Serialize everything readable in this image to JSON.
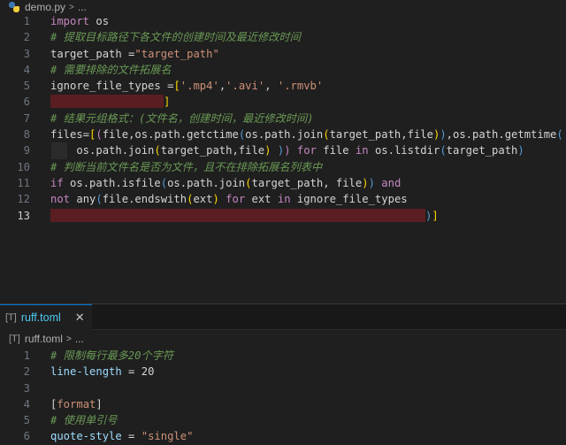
{
  "editor1": {
    "file_name": "demo.py",
    "breadcrumb_sep": ">",
    "breadcrumb_more": "...",
    "active_line": 13,
    "lines": [
      {
        "n": "1",
        "tokens": [
          {
            "t": "import",
            "c": "kw"
          },
          {
            "t": " os",
            "c": "pn"
          }
        ]
      },
      {
        "n": "2",
        "tokens": [
          {
            "t": "# 提取目标路径下各文件的创建时间及最近修改时间",
            "c": "cmt"
          }
        ]
      },
      {
        "n": "3",
        "tokens": [
          {
            "t": "target_path",
            "c": "pn"
          },
          {
            "t": " =",
            "c": "pn"
          },
          {
            "t": "\"target_path\"",
            "c": "str"
          }
        ]
      },
      {
        "n": "4",
        "tokens": [
          {
            "t": "# 需要排除的文件拓展名",
            "c": "cmt"
          }
        ]
      },
      {
        "n": "5",
        "tokens": [
          {
            "t": "ignore_file_types",
            "c": "pn"
          },
          {
            "t": " =",
            "c": "pn"
          },
          {
            "t": "[",
            "c": "brk"
          },
          {
            "t": "'.mp4'",
            "c": "str"
          },
          {
            "t": ",",
            "c": "pn"
          },
          {
            "t": "'.avi'",
            "c": "str"
          },
          {
            "t": ", ",
            "c": "pn"
          },
          {
            "t": "'.rmvb'",
            "c": "str"
          }
        ]
      },
      {
        "n": "6",
        "tokens": [
          {
            "t": "",
            "c": "redact",
            "w": 128
          },
          {
            "t": "]",
            "c": "brk"
          }
        ]
      },
      {
        "n": "7",
        "tokens": [
          {
            "t": "# 结果元组格式：(文件名，创建时间，最近修改时间)",
            "c": "cmt"
          }
        ]
      },
      {
        "n": "8",
        "tokens": [
          {
            "t": "files",
            "c": "pn"
          },
          {
            "t": "=",
            "c": "pn"
          },
          {
            "t": "[",
            "c": "brk"
          },
          {
            "t": "(",
            "c": "kw"
          },
          {
            "t": "file,os.path.getctime",
            "c": "pn"
          },
          {
            "t": "(",
            "c": "kw2"
          },
          {
            "t": "os.path.join",
            "c": "pn"
          },
          {
            "t": "(",
            "c": "brk"
          },
          {
            "t": "target_path,file",
            "c": "pn"
          },
          {
            "t": ")",
            "c": "brk"
          },
          {
            "t": ")",
            "c": "kw2"
          },
          {
            "t": ",os.path.getmtime",
            "c": "pn"
          },
          {
            "t": "(",
            "c": "kw2"
          }
        ]
      },
      {
        "n": "9",
        "indent": true,
        "tokens": [
          {
            "t": "    os.path.join",
            "c": "pn"
          },
          {
            "t": "(",
            "c": "brk"
          },
          {
            "t": "target_path,file",
            "c": "pn"
          },
          {
            "t": ")",
            "c": "brk"
          },
          {
            "t": " )",
            "c": "kw2"
          },
          {
            "t": ") ",
            "c": "kw"
          },
          {
            "t": "for",
            "c": "kw"
          },
          {
            "t": " file ",
            "c": "pn"
          },
          {
            "t": "in",
            "c": "kw"
          },
          {
            "t": " os.listdir",
            "c": "pn"
          },
          {
            "t": "(",
            "c": "kw2"
          },
          {
            "t": "target_path",
            "c": "pn"
          },
          {
            "t": ")",
            "c": "kw2"
          }
        ]
      },
      {
        "n": "10",
        "tokens": [
          {
            "t": "# 判断当前文件名是否为文件，且不在排除拓展名列表中",
            "c": "cmt"
          }
        ]
      },
      {
        "n": "11",
        "tokens": [
          {
            "t": "if",
            "c": "kw"
          },
          {
            "t": " os.path.isfile",
            "c": "pn"
          },
          {
            "t": "(",
            "c": "kw2"
          },
          {
            "t": "os.path.join",
            "c": "pn"
          },
          {
            "t": "(",
            "c": "brk"
          },
          {
            "t": "target_path, file",
            "c": "pn"
          },
          {
            "t": ")",
            "c": "brk"
          },
          {
            "t": ")",
            "c": "kw2"
          },
          {
            "t": " and",
            "c": "kw"
          }
        ]
      },
      {
        "n": "12",
        "tokens": [
          {
            "t": "not",
            "c": "kw"
          },
          {
            "t": " any",
            "c": "pn"
          },
          {
            "t": "(",
            "c": "kw2"
          },
          {
            "t": "file.endswith",
            "c": "pn"
          },
          {
            "t": "(",
            "c": "brk"
          },
          {
            "t": "ext",
            "c": "pn"
          },
          {
            "t": ")",
            "c": "brk"
          },
          {
            "t": " for",
            "c": "kw"
          },
          {
            "t": " ext ",
            "c": "pn"
          },
          {
            "t": "in",
            "c": "kw"
          },
          {
            "t": " ignore_file_types",
            "c": "pn"
          }
        ]
      },
      {
        "n": "13",
        "tokens": [
          {
            "t": "",
            "c": "redact",
            "w": 424
          },
          {
            "t": ")",
            "c": "kw2"
          },
          {
            "t": "]",
            "c": "brk"
          }
        ]
      }
    ]
  },
  "tab2": {
    "icon": "[T]",
    "file_name": "ruff.toml",
    "close_glyph": "✕"
  },
  "editor2": {
    "icon": "[T]",
    "file_name": "ruff.toml",
    "breadcrumb_sep": ">",
    "breadcrumb_more": "...",
    "lines": [
      {
        "n": "1",
        "tokens": [
          {
            "t": "# 限制每行最多20个字符",
            "c": "cmt"
          }
        ]
      },
      {
        "n": "2",
        "tokens": [
          {
            "t": "line-length",
            "c": "id"
          },
          {
            "t": " = ",
            "c": "pn"
          },
          {
            "t": "20",
            "c": "pn"
          }
        ]
      },
      {
        "n": "3",
        "tokens": []
      },
      {
        "n": "4",
        "tokens": [
          {
            "t": "[",
            "c": "pn"
          },
          {
            "t": "format",
            "c": "str"
          },
          {
            "t": "]",
            "c": "pn"
          }
        ]
      },
      {
        "n": "5",
        "tokens": [
          {
            "t": "# 使用单引号",
            "c": "cmt"
          }
        ]
      },
      {
        "n": "6",
        "tokens": [
          {
            "t": "quote-style",
            "c": "id"
          },
          {
            "t": " = ",
            "c": "pn"
          },
          {
            "t": "\"single\"",
            "c": "str"
          }
        ]
      }
    ]
  }
}
